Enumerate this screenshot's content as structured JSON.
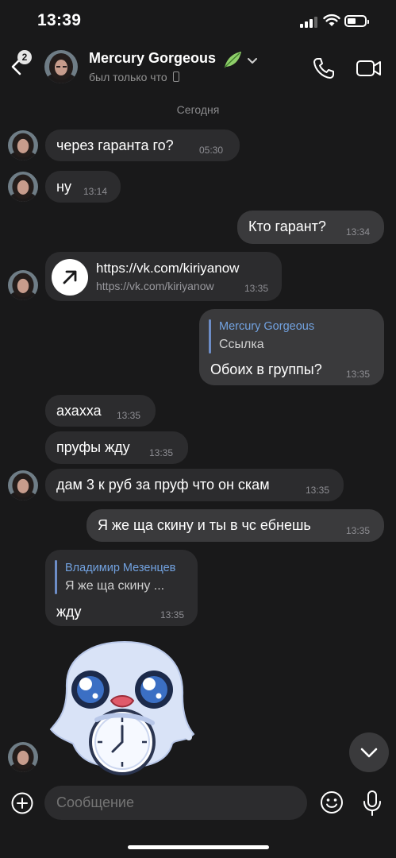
{
  "status_bar": {
    "time": "13:39"
  },
  "header": {
    "back_badge": "2",
    "title": "Mercury Gorgeous",
    "subtitle": "был только что"
  },
  "date_separator": "Сегодня",
  "messages": [
    {
      "text": "через гаранта го?",
      "time": "05:30"
    },
    {
      "text": "ну",
      "time": "13:14"
    },
    {
      "text": "Кто гарант?",
      "time": "13:34"
    },
    {
      "link_title": "https://vk.com/kiriyanow",
      "link_url": "https://vk.com/kiriyanow",
      "time": "13:35"
    },
    {
      "quote_name": "Mercury Gorgeous",
      "quote_text": "Ссылка",
      "text": "Обоих в группы?",
      "time": "13:35"
    },
    {
      "text": "ахахха",
      "time": "13:35"
    },
    {
      "text": "пруфы жду",
      "time": "13:35"
    },
    {
      "text": "дам 3 к руб за пруф что он скам",
      "time": "13:35"
    },
    {
      "text": "Я же ща скину и ты в чс ебнешь",
      "time": "13:35"
    },
    {
      "quote_name": "Владимир Мезенцев",
      "quote_text": "Я же ща скину ...",
      "text": "жду",
      "time": "13:35"
    }
  ],
  "input": {
    "placeholder": "Сообщение"
  },
  "colors": {
    "background": "#19191a",
    "bubble_in": "#2c2c2e",
    "bubble_out": "#3a3a3c",
    "quote_accent": "#72a2e0"
  },
  "icons": [
    "back-arrow-icon",
    "phone-icon",
    "video-camera-icon",
    "leaf-icon",
    "chevron-down-icon",
    "arrow-up-right-icon",
    "plus-icon",
    "emoji-icon",
    "microphone-icon",
    "arrow-down-icon"
  ]
}
